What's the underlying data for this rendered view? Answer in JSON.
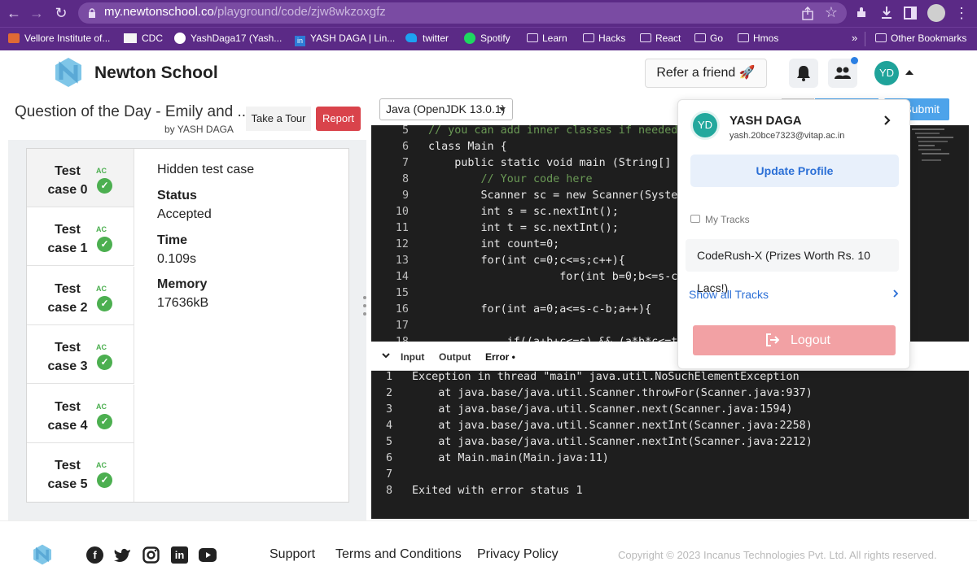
{
  "browser": {
    "url_host": "my.newtonschool.co",
    "url_path": "/playground/code/zjw8wkzoxgfz",
    "bookmarks": [
      "Vellore Institute of...",
      "CDC",
      "YashDaga17 (Yash...",
      "YASH DAGA | Lin...",
      "twitter",
      "Spotify",
      "Learn",
      "Hacks",
      "React",
      "Go",
      "Hmos"
    ],
    "more_bookmarks": "»",
    "other_bookmarks": "Other Bookmarks",
    "colors": {
      "chrome": "#5b2a86"
    }
  },
  "header": {
    "brand": "Newton School",
    "refer_label": "Refer a friend 🚀",
    "avatar_initials": "YD"
  },
  "question": {
    "title": "Question of the Day - Emily and ...",
    "by": "by YASH DAGA",
    "tour_label": "Take a Tour",
    "report_label": "Report"
  },
  "testcases": [
    {
      "line1": "Test",
      "line2": "case 0",
      "status": "AC"
    },
    {
      "line1": "Test",
      "line2": "case 1",
      "status": "AC"
    },
    {
      "line1": "Test",
      "line2": "case 2",
      "status": "AC"
    },
    {
      "line1": "Test",
      "line2": "case 3",
      "status": "AC"
    },
    {
      "line1": "Test",
      "line2": "case 4",
      "status": "AC"
    },
    {
      "line1": "Test",
      "line2": "case 5",
      "status": "AC"
    }
  ],
  "details": {
    "title": "Hidden test case",
    "status_label": "Status",
    "status_value": "Accepted",
    "time_label": "Time",
    "time_value": "0.109s",
    "memory_label": "Memory",
    "memory_value": "17636kB"
  },
  "editor": {
    "language": "Java (OpenJDK 13.0.1)",
    "submit_label": "Submit",
    "lines": [
      {
        "n": "5",
        "t": "// you can add inner classes if needed"
      },
      {
        "n": "6",
        "t": "class Main {"
      },
      {
        "n": "7",
        "t": "    public static void main (String[] a"
      },
      {
        "n": "8",
        "t": "        // Your code here"
      },
      {
        "n": "9",
        "t": "        Scanner sc = new Scanner(System"
      },
      {
        "n": "10",
        "t": "        int s = sc.nextInt();"
      },
      {
        "n": "11",
        "t": "        int t = sc.nextInt();"
      },
      {
        "n": "12",
        "t": "        int count=0;"
      },
      {
        "n": "13",
        "t": "        for(int c=0;c<=s;c++){"
      },
      {
        "n": "14",
        "t": "                    for(int b=0;b<=s-c;"
      },
      {
        "n": "15",
        "t": ""
      },
      {
        "n": "16",
        "t": "        for(int a=0;a<=s-c-b;a++){"
      },
      {
        "n": "17",
        "t": ""
      },
      {
        "n": "18",
        "t": "            if((a+b+c<=s) && (a*b*c<=t)"
      }
    ]
  },
  "io": {
    "tabs": [
      "Input",
      "Output",
      "Error •"
    ],
    "output": [
      {
        "n": "1",
        "t": "Exception in thread \"main\" java.util.NoSuchElementException"
      },
      {
        "n": "2",
        "t": "    at java.base/java.util.Scanner.throwFor(Scanner.java:937)"
      },
      {
        "n": "3",
        "t": "    at java.base/java.util.Scanner.next(Scanner.java:1594)"
      },
      {
        "n": "4",
        "t": "    at java.base/java.util.Scanner.nextInt(Scanner.java:2258)"
      },
      {
        "n": "5",
        "t": "    at java.base/java.util.Scanner.nextInt(Scanner.java:2212)"
      },
      {
        "n": "6",
        "t": "    at Main.main(Main.java:11)"
      },
      {
        "n": "7",
        "t": ""
      },
      {
        "n": "8",
        "t": "Exited with error status 1"
      }
    ]
  },
  "profile_menu": {
    "initials": "YD",
    "name": "YASH DAGA",
    "email": "yash.20bce7323@vitap.ac.in",
    "update_label": "Update Profile",
    "tracks_heading": "My Tracks",
    "track_item": "CodeRush-X (Prizes Worth Rs. 10 Lacs!)",
    "show_all_label": "Show all Tracks",
    "logout_label": "Logout"
  },
  "footer": {
    "links": [
      "Support",
      "Terms and Conditions",
      "Privacy Policy"
    ],
    "copyright": "Copyright © 2023 Incanus Technologies Pvt. Ltd. All rights reserved."
  }
}
